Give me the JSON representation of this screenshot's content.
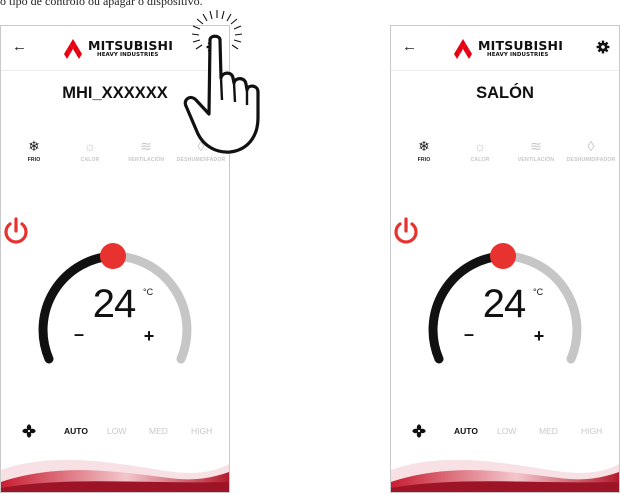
{
  "caption": "o tipo de controlo ou apagar o dispositivo.",
  "brand": {
    "name": "MITSUBISHI",
    "subtitle": "HEAVY INDUSTRIES",
    "logo_color": "#e60012"
  },
  "icons": {
    "back": "back-arrow-icon",
    "settings": "gear-icon",
    "power": "power-icon",
    "fan": "fan-icon",
    "touch": "pointing-hand-icon"
  },
  "modes": [
    {
      "label": "FRIO",
      "icon": "snowflake-icon",
      "active": true
    },
    {
      "label": "CALOR",
      "icon": "sun-icon",
      "active": false
    },
    {
      "label": "VENTILACIÓN",
      "icon": "wind-icon",
      "active": false
    },
    {
      "label": "DESHUMIDIFADOR",
      "icon": "drop-icon",
      "active": false
    }
  ],
  "screens": [
    {
      "device_name": "MHI_XXXXXX",
      "temperature": "24",
      "unit": "°C",
      "minus": "–",
      "plus": "+",
      "fan_speeds": [
        "AUTO",
        "LOW",
        "MED",
        "HIGH"
      ],
      "fan_selected": "AUTO"
    },
    {
      "device_name": "SALÓN",
      "temperature": "24",
      "unit": "°C",
      "minus": "–",
      "plus": "+",
      "fan_speeds": [
        "AUTO",
        "LOW",
        "MED",
        "HIGH"
      ],
      "fan_selected": "AUTO"
    }
  ],
  "colors": {
    "accent_red": "#e8322f",
    "dial_dark": "#111111",
    "dial_light": "#c6c6c6",
    "wave": "#b31b2c"
  }
}
